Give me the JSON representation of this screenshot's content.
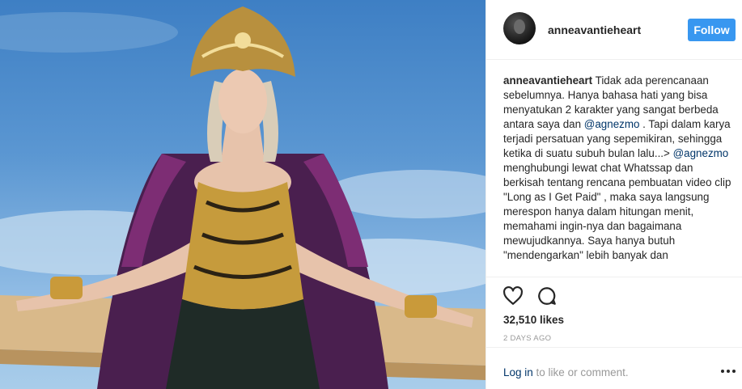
{
  "post": {
    "username": "anneavantieheart",
    "follow_label": "Follow",
    "caption": {
      "user": "anneavantieheart",
      "parts": [
        {
          "text": " Tidak ada perencanaan sebelumnya. Hanya bahasa hati yang bisa menyatukan 2 karakter yang sangat berbeda antara saya dan "
        },
        {
          "text": "@agnezmo",
          "mention": true
        },
        {
          "text": " . Tapi dalam karya terjadi persatuan yang sepemikiran, sehingga ketika di suatu subuh bulan lalu...> "
        },
        {
          "text": "@agnezmo",
          "mention": true
        },
        {
          "text": " menghubungi lewat chat Whatssap dan berkisah tentang rencana pembuatan video clip \"Long as I Get Paid\" , maka saya langsung merespon hanya dalam hitungan menit, memahami ingin-nya dan bagaimana mewujudkannya. Saya hanya butuh \"mendengarkan\" lebih banyak dan"
        }
      ]
    },
    "likes": "32,510 likes",
    "time_ago": "2 DAYS AGO",
    "login_link": "Log in",
    "login_rest": " to like or comment.",
    "icons": {
      "like": "heart-icon",
      "comment": "comment-bubble-icon",
      "more": "more-options-icon"
    }
  },
  "colors": {
    "follow_button": "#3897f0",
    "mention": "#003569",
    "muted": "#999999",
    "text": "#262626"
  }
}
